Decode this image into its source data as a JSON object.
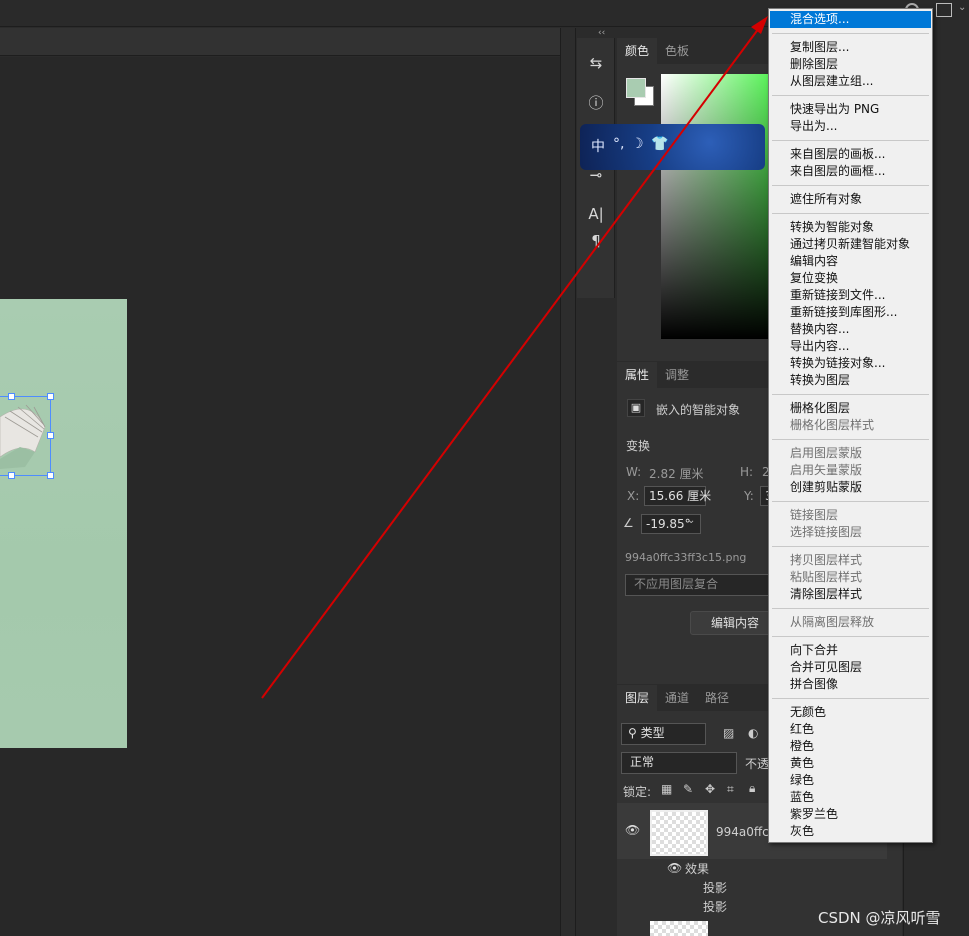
{
  "panels": {
    "color": {
      "tabs": [
        "颜色",
        "色板"
      ]
    },
    "properties": {
      "tabs": [
        "属性",
        "调整"
      ],
      "object_type": "嵌入的智能对象",
      "transform_label": "变换",
      "w_label": "W:",
      "w_value": "2.82 厘米",
      "h_label": "H:",
      "h_value": "2",
      "x_label": "X:",
      "x_value": "15.66 厘米",
      "y_label": "Y:",
      "y_value": "3",
      "angle_value": "-19.85°",
      "filename": "994a0ffc33ff3c15.png",
      "comp_placeholder": "不应用图层复合",
      "edit_button": "编辑内容"
    },
    "layers": {
      "tabs": [
        "图层",
        "通道",
        "路径"
      ],
      "filter_label": "类型",
      "blend_mode": "正常",
      "opacity_label": "不透",
      "lock_label": "锁定:",
      "layer_name": "994a0ffc33",
      "effects_label": "效果",
      "effect_items": [
        "投影",
        "投影"
      ]
    }
  },
  "ime": {
    "items": [
      "中",
      "°,",
      "☽",
      "👕"
    ]
  },
  "context_menu": {
    "items": [
      {
        "label": "混合选项...",
        "state": "selected"
      },
      {
        "sep": true
      },
      {
        "label": "复制图层...",
        "state": "enabled"
      },
      {
        "label": "删除图层",
        "state": "enabled"
      },
      {
        "label": "从图层建立组...",
        "state": "enabled"
      },
      {
        "sep": true
      },
      {
        "label": "快速导出为 PNG",
        "state": "enabled"
      },
      {
        "label": "导出为...",
        "state": "enabled"
      },
      {
        "sep": true
      },
      {
        "label": "来自图层的画板...",
        "state": "enabled"
      },
      {
        "label": "来自图层的画框...",
        "state": "enabled"
      },
      {
        "sep": true
      },
      {
        "label": "遮住所有对象",
        "state": "enabled"
      },
      {
        "sep": true
      },
      {
        "label": "转换为智能对象",
        "state": "enabled"
      },
      {
        "label": "通过拷贝新建智能对象",
        "state": "enabled"
      },
      {
        "label": "编辑内容",
        "state": "enabled"
      },
      {
        "label": "复位变换",
        "state": "enabled"
      },
      {
        "label": "重新链接到文件...",
        "state": "enabled"
      },
      {
        "label": "重新链接到库图形...",
        "state": "enabled"
      },
      {
        "label": "替换内容...",
        "state": "enabled"
      },
      {
        "label": "导出内容...",
        "state": "enabled"
      },
      {
        "label": "转换为链接对象...",
        "state": "enabled"
      },
      {
        "label": "转换为图层",
        "state": "enabled"
      },
      {
        "sep": true
      },
      {
        "label": "栅格化图层",
        "state": "enabled"
      },
      {
        "label": "栅格化图层样式",
        "state": "disabled"
      },
      {
        "sep": true
      },
      {
        "label": "启用图层蒙版",
        "state": "disabled"
      },
      {
        "label": "启用矢量蒙版",
        "state": "disabled"
      },
      {
        "label": "创建剪贴蒙版",
        "state": "enabled"
      },
      {
        "sep": true
      },
      {
        "label": "链接图层",
        "state": "disabled"
      },
      {
        "label": "选择链接图层",
        "state": "disabled"
      },
      {
        "sep": true
      },
      {
        "label": "拷贝图层样式",
        "state": "disabled"
      },
      {
        "label": "粘贴图层样式",
        "state": "disabled"
      },
      {
        "label": "清除图层样式",
        "state": "enabled"
      },
      {
        "sep": true
      },
      {
        "label": "从隔离图层释放",
        "state": "disabled"
      },
      {
        "sep": true
      },
      {
        "label": "向下合并",
        "state": "enabled"
      },
      {
        "label": "合并可见图层",
        "state": "enabled"
      },
      {
        "label": "拼合图像",
        "state": "enabled"
      },
      {
        "sep": true
      },
      {
        "label": "无颜色",
        "state": "enabled"
      },
      {
        "label": "红色",
        "state": "enabled"
      },
      {
        "label": "橙色",
        "state": "enabled"
      },
      {
        "label": "黄色",
        "state": "enabled"
      },
      {
        "label": "绿色",
        "state": "enabled"
      },
      {
        "label": "蓝色",
        "state": "enabled"
      },
      {
        "label": "紫罗兰色",
        "state": "enabled"
      },
      {
        "label": "灰色",
        "state": "enabled"
      }
    ]
  },
  "watermark": "CSDN @凉风听雪",
  "colors": {
    "foreground": "#a9ccb1",
    "background": "#ffffff",
    "menu_highlight": "#0078d7",
    "annotation_arrow": "#d40000"
  }
}
